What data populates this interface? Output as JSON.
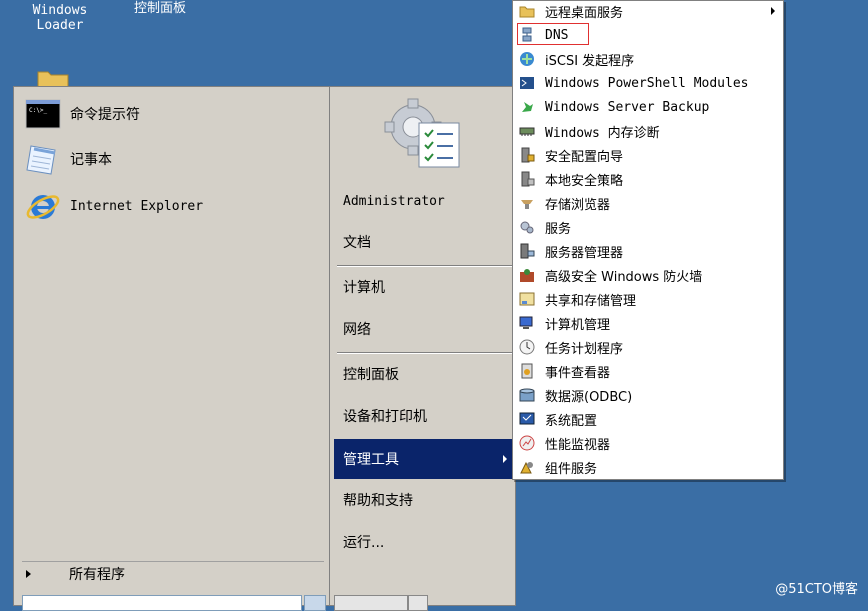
{
  "desktop": {
    "icons": [
      {
        "label_line1": "Windows",
        "label_line2": "Loader"
      },
      {
        "label_line1": "控制面板",
        "label_line2": ""
      }
    ]
  },
  "start_menu": {
    "pinned_programs": [
      {
        "label": "命令提示符",
        "icon": "cmd-icon"
      },
      {
        "label": "记事本",
        "icon": "notepad-icon"
      },
      {
        "label": "Internet Explorer",
        "icon": "ie-icon"
      }
    ],
    "all_programs_label": "所有程序",
    "right_items": {
      "user": "Administrator",
      "documents": "文档",
      "computer": "计算机",
      "network": "网络",
      "control_panel": "控制面板",
      "devices_printers": "设备和打印机",
      "admin_tools": "管理工具",
      "help_support": "帮助和支持",
      "run": "运行..."
    }
  },
  "admin_tools_submenu": {
    "items": [
      {
        "label": "远程桌面服务",
        "icon": "folder-icon",
        "has_submenu": true
      },
      {
        "label": "DNS",
        "icon": "dns-icon",
        "highlighted": true
      },
      {
        "label": "iSCSI 发起程序",
        "icon": "iscsi-icon"
      },
      {
        "label": "Windows PowerShell Modules",
        "icon": "powershell-icon"
      },
      {
        "label": "Windows Server Backup",
        "icon": "backup-icon"
      },
      {
        "label": "Windows 内存诊断",
        "icon": "memory-icon"
      },
      {
        "label": "安全配置向导",
        "icon": "security-wizard-icon"
      },
      {
        "label": "本地安全策略",
        "icon": "local-policy-icon"
      },
      {
        "label": "存储浏览器",
        "icon": "storage-explorer-icon"
      },
      {
        "label": "服务",
        "icon": "services-icon"
      },
      {
        "label": "服务器管理器",
        "icon": "server-manager-icon"
      },
      {
        "label": "高级安全 Windows 防火墙",
        "icon": "firewall-icon"
      },
      {
        "label": "共享和存储管理",
        "icon": "share-storage-icon"
      },
      {
        "label": "计算机管理",
        "icon": "computer-management-icon"
      },
      {
        "label": "任务计划程序",
        "icon": "task-scheduler-icon"
      },
      {
        "label": "事件查看器",
        "icon": "event-viewer-icon"
      },
      {
        "label": "数据源(ODBC)",
        "icon": "odbc-icon"
      },
      {
        "label": "系统配置",
        "icon": "system-config-icon"
      },
      {
        "label": "性能监视器",
        "icon": "performance-monitor-icon"
      },
      {
        "label": "组件服务",
        "icon": "component-services-icon"
      }
    ]
  },
  "watermark": "@51CTO博客",
  "colors": {
    "desktop": "#3a6ea5",
    "menu_bg": "#d4d0c8",
    "highlight": "#0a246a",
    "dns_outline": "#e03030"
  }
}
